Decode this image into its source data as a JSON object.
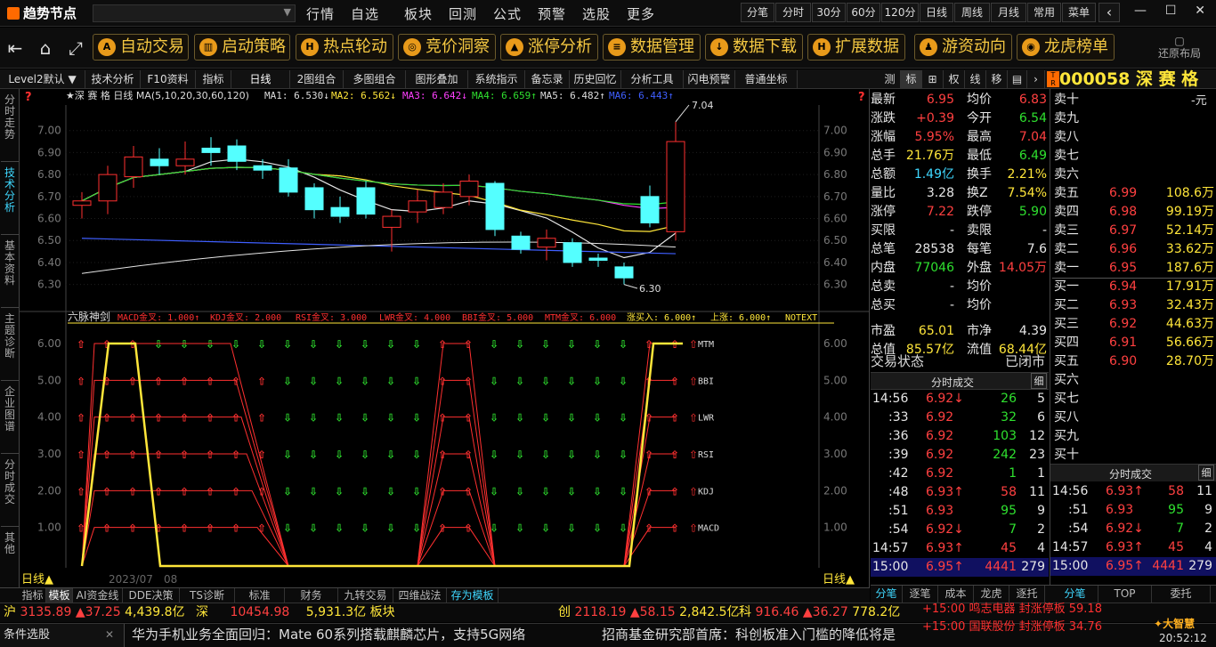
{
  "app": {
    "logo": "趋势节点"
  },
  "menu": [
    "行情",
    "自选",
    "板块",
    "回测",
    "公式",
    "预警",
    "选股",
    "更多"
  ],
  "period_buttons": [
    "分笔",
    "分时",
    "30分",
    "60分",
    "120分",
    "日线",
    "周线",
    "月线",
    "常用",
    "菜单"
  ],
  "toolbar": {
    "buttons": [
      "自动交易",
      "启动策略",
      "热点轮动",
      "竞价洞察",
      "涨停分析",
      "数据管理",
      "数据下载",
      "扩展数据",
      "游资动向",
      "龙虎榜单"
    ],
    "restore_layout": "还原布局"
  },
  "tabs": [
    "Level2默认",
    "技术分析",
    "F10资料",
    "指标",
    "日线",
    "2图组合",
    "多图组合",
    "图形叠加",
    "系统指示",
    "备忘录",
    "历史回忆",
    "分析工具",
    "闪电预警",
    "普通坐标"
  ],
  "right_tabs": [
    "测",
    "标",
    "权",
    "线",
    "移"
  ],
  "stock": {
    "code": "000058",
    "name": "深 赛 格"
  },
  "left_sidebar": [
    "分时走势",
    "技术分析",
    "基本资料",
    "主题诊断",
    "企业图谱",
    "分时成交",
    "其他"
  ],
  "chart": {
    "title": "★深 赛 格 日线 MA(5,10,20,30,60,120)",
    "ma_labels": [
      "MA1: 6.530↓",
      "MA2: 6.562↓",
      "MA3: 6.642↓",
      "MA4: 6.659↑",
      "MA5: 6.482↑",
      "MA6: 6.443↑"
    ],
    "high_label": "7.04",
    "low_label": "6.30",
    "y_ticks": [
      "7.00",
      "6.90",
      "6.80",
      "6.70",
      "6.60",
      "6.50",
      "6.40",
      "6.30"
    ],
    "indicator_title": "六脉神剑",
    "indicator_legend": [
      "MACD金叉: 1.000↑",
      "KDJ金叉: 2.000",
      "RSI金叉: 3.000",
      "LWR金叉: 4.000",
      "BBI金叉: 5.000",
      "MTM金叉: 6.000",
      "涨买入: 6.000↑",
      "上涨: 6.000↑",
      "NOTEXT"
    ],
    "indicator_y_ticks": [
      "6.00",
      "5.00",
      "4.00",
      "3.00",
      "2.00",
      "1.00"
    ],
    "indicator_lines": [
      "MTM",
      "BBI",
      "LWR",
      "RSI",
      "KDJ",
      "MACD"
    ],
    "x_label": "2023/07",
    "x_label2": "08",
    "period_corner": "日线▲"
  },
  "chart_data": {
    "type": "candlestick",
    "candles": [
      {
        "o": 6.66,
        "c": 6.68,
        "h": 6.72,
        "l": 6.6
      },
      {
        "o": 6.68,
        "c": 6.8,
        "h": 6.84,
        "l": 6.62
      },
      {
        "o": 6.79,
        "c": 6.88,
        "h": 6.93,
        "l": 6.74
      },
      {
        "o": 6.87,
        "c": 6.84,
        "h": 6.92,
        "l": 6.8
      },
      {
        "o": 6.84,
        "c": 6.87,
        "h": 6.95,
        "l": 6.8
      },
      {
        "o": 6.92,
        "c": 6.9,
        "h": 6.97,
        "l": 6.84
      },
      {
        "o": 6.93,
        "c": 6.86,
        "h": 6.96,
        "l": 6.82
      },
      {
        "o": 6.84,
        "c": 6.82,
        "h": 6.87,
        "l": 6.78
      },
      {
        "o": 6.83,
        "c": 6.72,
        "h": 6.87,
        "l": 6.7
      },
      {
        "o": 6.74,
        "c": 6.64,
        "h": 6.76,
        "l": 6.6
      },
      {
        "o": 6.65,
        "c": 6.61,
        "h": 6.7,
        "l": 6.58
      },
      {
        "o": 6.74,
        "c": 6.62,
        "h": 6.77,
        "l": 6.6
      },
      {
        "o": 6.56,
        "c": 6.61,
        "h": 6.64,
        "l": 6.45
      },
      {
        "o": 6.63,
        "c": 6.68,
        "h": 6.73,
        "l": 6.58
      },
      {
        "o": 6.65,
        "c": 6.72,
        "h": 6.76,
        "l": 6.62
      },
      {
        "o": 6.7,
        "c": 6.77,
        "h": 6.8,
        "l": 6.66
      },
      {
        "o": 6.76,
        "c": 6.55,
        "h": 6.77,
        "l": 6.52
      },
      {
        "o": 6.52,
        "c": 6.46,
        "h": 6.54,
        "l": 6.44
      },
      {
        "o": 6.47,
        "c": 6.51,
        "h": 6.55,
        "l": 6.41
      },
      {
        "o": 6.49,
        "c": 6.4,
        "h": 6.51,
        "l": 6.38
      },
      {
        "o": 6.42,
        "c": 6.41,
        "h": 6.44,
        "l": 6.38
      },
      {
        "o": 6.38,
        "c": 6.33,
        "h": 6.4,
        "l": 6.3
      },
      {
        "o": 6.7,
        "c": 6.58,
        "h": 6.75,
        "l": 6.56
      },
      {
        "o": 6.54,
        "c": 6.95,
        "h": 7.04,
        "l": 6.5
      }
    ],
    "ylim": [
      6.25,
      7.1
    ]
  },
  "quote": {
    "left_rows": [
      {
        "k1": "最新",
        "v1": "6.95",
        "c1": "red",
        "k2": "均价",
        "v2": "6.83",
        "c2": "red"
      },
      {
        "k1": "涨跌",
        "v1": "+0.39",
        "c1": "red",
        "k2": "今开",
        "v2": "6.54",
        "c2": "grn"
      },
      {
        "k1": "涨幅",
        "v1": "5.95%",
        "c1": "red",
        "k2": "最高",
        "v2": "7.04",
        "c2": "red"
      },
      {
        "k1": "总手",
        "v1": "21.76万",
        "c1": "yel",
        "k2": "最低",
        "v2": "6.49",
        "c2": "grn"
      },
      {
        "k1": "总额",
        "v1": "1.49亿",
        "c1": "cyan",
        "k2": "换手",
        "v2": "2.21%",
        "c2": "yel"
      },
      {
        "k1": "量比",
        "v1": "3.28",
        "c1": "wht",
        "k2": "换Z",
        "v2": "7.54%",
        "c2": "yel"
      },
      {
        "k1": "涨停",
        "v1": "7.22",
        "c1": "red",
        "k2": "跌停",
        "v2": "5.90",
        "c2": "grn"
      },
      {
        "k1": "买限",
        "v1": "-",
        "c1": "wht",
        "k2": "卖限",
        "v2": "-",
        "c2": "wht"
      },
      {
        "k1": "总笔",
        "v1": "28538",
        "c1": "wht",
        "k2": "每笔",
        "v2": "7.6",
        "c2": "wht"
      },
      {
        "k1": "内盘",
        "v1": "77046",
        "c1": "grn",
        "k2": "外盘",
        "v2": "14.05万",
        "c2": "red"
      },
      {
        "k1": "总卖",
        "v1": "-",
        "c1": "wht",
        "k2": "均价",
        "v2": "",
        "c2": "wht"
      },
      {
        "k1": "总买",
        "v1": "-",
        "c1": "wht",
        "k2": "均价",
        "v2": "",
        "c2": "wht"
      },
      {
        "k1": "市盈",
        "v1": "65.01",
        "c1": "yel",
        "k2": "市净",
        "v2": "4.39",
        "c2": "wht"
      },
      {
        "k1": "总值",
        "v1": "85.57亿",
        "c1": "yel",
        "k2": "流值",
        "v2": "68.44亿",
        "c2": "yel"
      }
    ],
    "trade_status_label": "交易状态",
    "trade_status_value": "已闭市",
    "ticks_title": "分时成交",
    "ticks_detail": "细",
    "ticks": [
      {
        "t": "14:56",
        "p": "6.92",
        "d": "↓",
        "v": "26",
        "n": "5",
        "vc": "grn"
      },
      {
        "t": ":33",
        "p": "6.92",
        "d": "",
        "v": "32",
        "n": "6",
        "vc": "grn"
      },
      {
        "t": ":36",
        "p": "6.92",
        "d": "",
        "v": "103",
        "n": "12",
        "vc": "grn"
      },
      {
        "t": ":39",
        "p": "6.92",
        "d": "",
        "v": "242",
        "n": "23",
        "vc": "grn"
      },
      {
        "t": ":42",
        "p": "6.92",
        "d": "",
        "v": "1",
        "n": "1",
        "vc": "grn"
      },
      {
        "t": ":48",
        "p": "6.93",
        "d": "↑",
        "v": "58",
        "n": "11",
        "vc": "red"
      },
      {
        "t": ":51",
        "p": "6.93",
        "d": "",
        "v": "95",
        "n": "9",
        "vc": "grn"
      },
      {
        "t": ":54",
        "p": "6.92",
        "d": "↓",
        "v": "7",
        "n": "2",
        "vc": "grn"
      },
      {
        "t": "14:57",
        "p": "6.93",
        "d": "↑",
        "v": "45",
        "n": "4",
        "vc": "red"
      },
      {
        "t": "15:00",
        "p": "6.95",
        "d": "↑",
        "v": "4441",
        "n": "279",
        "vc": "red"
      }
    ],
    "ticks2": [
      {
        "t": "14:56",
        "p": "6.93",
        "d": "↑",
        "v": "58",
        "n": "11",
        "vc": "red"
      },
      {
        "t": ":51",
        "p": "6.93",
        "d": "",
        "v": "95",
        "n": "9",
        "vc": "grn"
      },
      {
        "t": ":54",
        "p": "6.92",
        "d": "↓",
        "v": "7",
        "n": "2",
        "vc": "grn"
      },
      {
        "t": "14:57",
        "p": "6.93",
        "d": "↑",
        "v": "45",
        "n": "4",
        "vc": "red"
      },
      {
        "t": "15:00",
        "p": "6.95",
        "d": "↑",
        "v": "4441",
        "n": "279",
        "vc": "red"
      }
    ],
    "unit": "-元",
    "sells": [
      {
        "k": "卖十",
        "p": "",
        "v": ""
      },
      {
        "k": "卖九",
        "p": "",
        "v": ""
      },
      {
        "k": "卖八",
        "p": "",
        "v": ""
      },
      {
        "k": "卖七",
        "p": "",
        "v": ""
      },
      {
        "k": "卖六",
        "p": "",
        "v": ""
      },
      {
        "k": "卖五",
        "p": "6.99",
        "v": "108.6万"
      },
      {
        "k": "卖四",
        "p": "6.98",
        "v": "99.19万"
      },
      {
        "k": "卖三",
        "p": "6.97",
        "v": "52.14万"
      },
      {
        "k": "卖二",
        "p": "6.96",
        "v": "33.62万"
      },
      {
        "k": "卖一",
        "p": "6.95",
        "v": "187.6万"
      }
    ],
    "buys": [
      {
        "k": "买一",
        "p": "6.94",
        "v": "17.91万"
      },
      {
        "k": "买二",
        "p": "6.93",
        "v": "32.43万"
      },
      {
        "k": "买三",
        "p": "6.92",
        "v": "44.63万"
      },
      {
        "k": "买四",
        "p": "6.91",
        "v": "56.66万"
      },
      {
        "k": "买五",
        "p": "6.90",
        "v": "28.70万"
      },
      {
        "k": "买六",
        "p": "",
        "v": ""
      },
      {
        "k": "买七",
        "p": "",
        "v": ""
      },
      {
        "k": "买八",
        "p": "",
        "v": ""
      },
      {
        "k": "买九",
        "p": "",
        "v": ""
      },
      {
        "k": "买十",
        "p": "",
        "v": ""
      }
    ],
    "bottom_tabs_left": [
      "分笔",
      "逐笔",
      "成本",
      "龙虎",
      "逐托"
    ],
    "bottom_tabs_right": [
      "分笔",
      "TOP",
      "委托"
    ]
  },
  "bottom_tabs": [
    "指标",
    "模板",
    "AI资金线",
    "DDE决策",
    "TS诊断",
    "标准",
    "财务",
    "九转交易",
    "四维战法",
    "存为模板"
  ],
  "status1": {
    "items": [
      {
        "name": "沪",
        "val": "3135.89",
        "chg": "▲37.25",
        "amt": "4,439.8亿"
      },
      {
        "name": "深",
        "val": "10454.98",
        "chg": "",
        "amt": "5,931.3亿"
      },
      {
        "name": "创",
        "val": "2118.19",
        "chg": "▲58.15",
        "amt": "2,842.5亿"
      },
      {
        "name": "科",
        "val": "916.46",
        "chg": "▲36.27",
        "amt": "778.2亿"
      }
    ],
    "board": "板块",
    "alerts": [
      "+15:00 鸣志电器 封涨停板 59.18",
      "+15:00 国联股份 封涨停板 34.76"
    ]
  },
  "status2": {
    "cond": "条件选股",
    "news1": "华为手机业务全面回归：Mate 60系列搭载麒麟芯片，支持5G网络",
    "news2": "招商基金研究部首席：科创板准入门槛的降低将是",
    "brand": "大智慧",
    "time": "20:52:12"
  }
}
